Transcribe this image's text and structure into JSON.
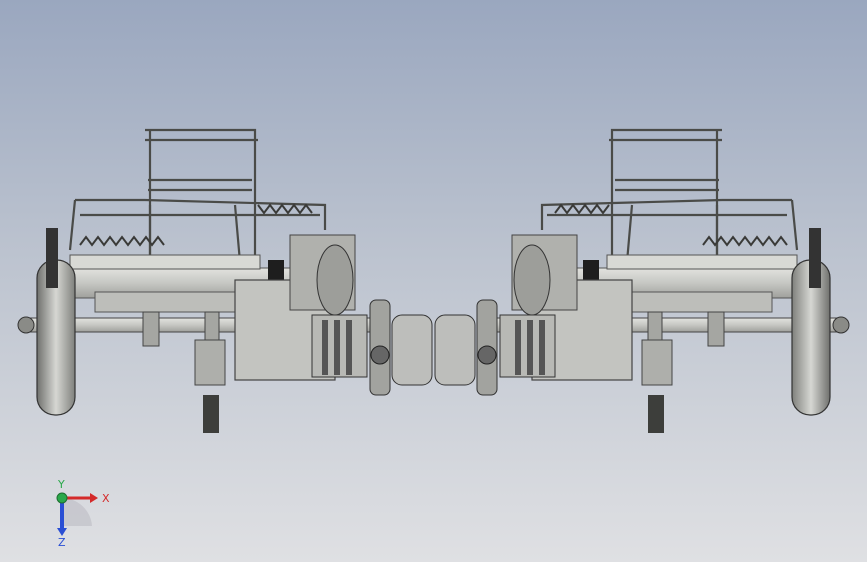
{
  "viewport": {
    "background_top": "#9aa7bf",
    "background_bottom": "#dfe0e3"
  },
  "model": {
    "description_icon": "twin-chassis-assembly",
    "body_color": "#c9cac6",
    "shadow_color": "#8c8d8a",
    "frame_color": "#b7b8b4",
    "belt_color": "#1e1e1e"
  },
  "triad": {
    "x_label": "X",
    "y_label": "Y",
    "z_label": "Z",
    "x_color": "#d42a2a",
    "y_color": "#2aa84a",
    "z_color": "#2a4fd4"
  }
}
